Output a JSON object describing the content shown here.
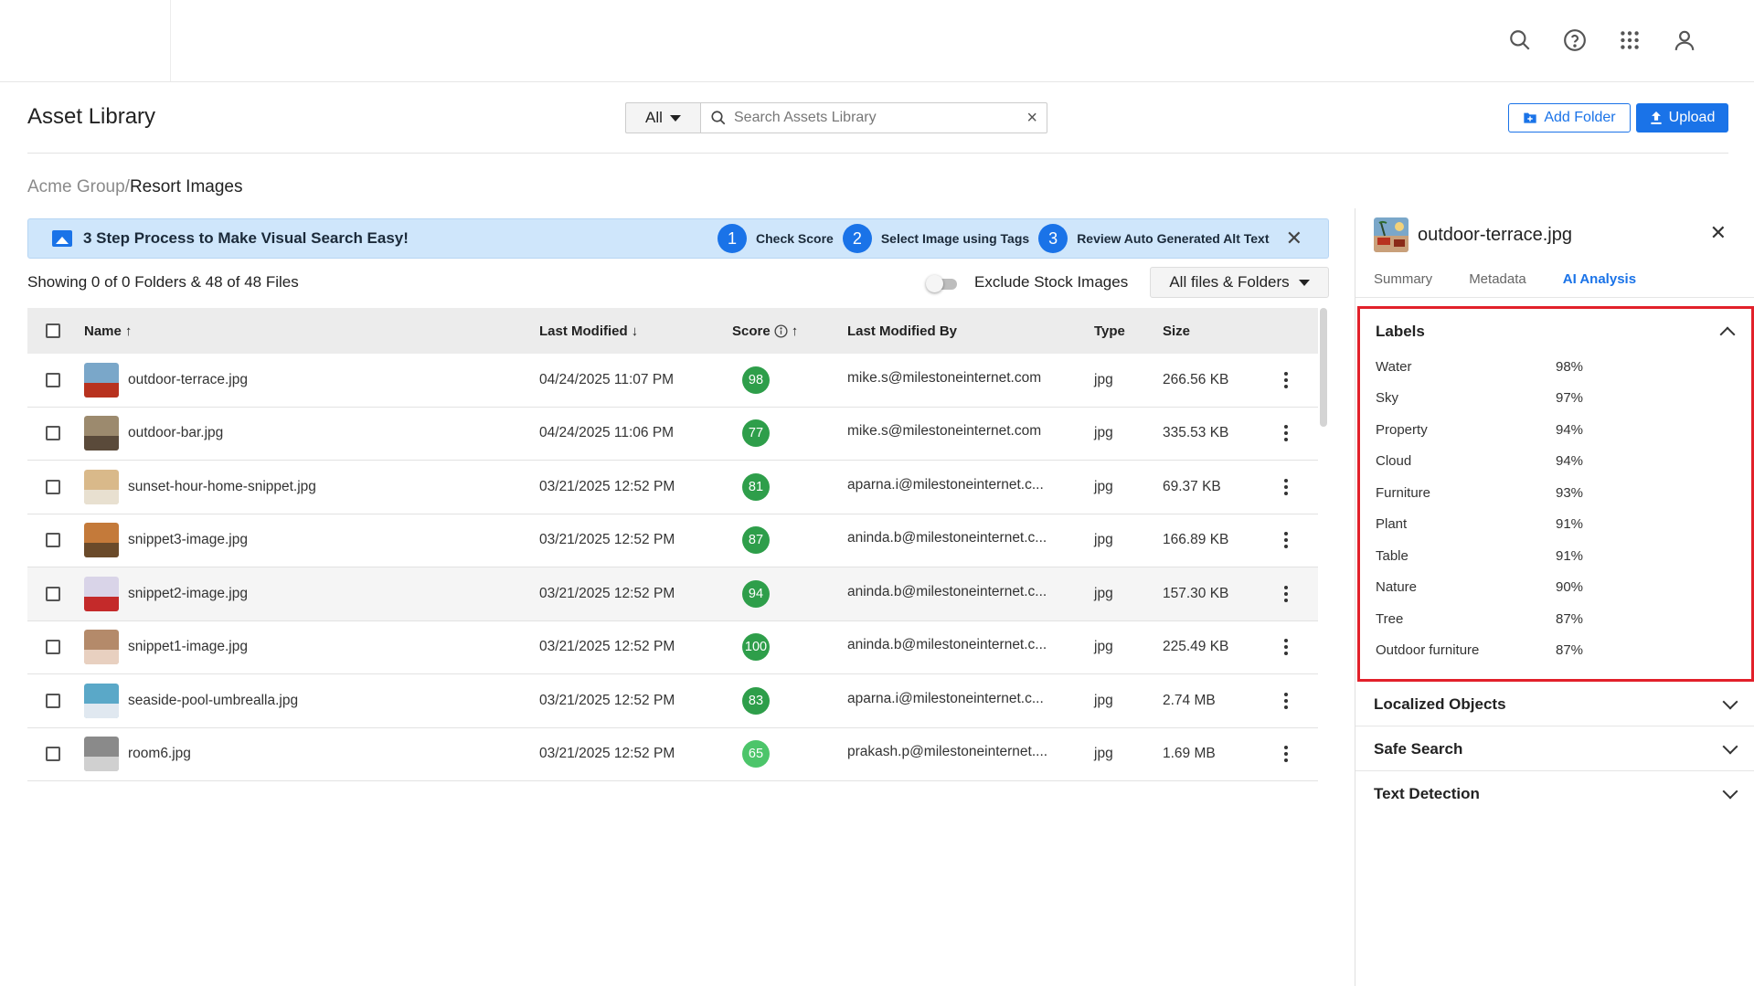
{
  "header": {
    "icons": [
      "search-icon",
      "help-icon",
      "apps-grid-icon",
      "account-icon"
    ]
  },
  "page": {
    "title": "Asset Library",
    "scope": "All",
    "search_placeholder": "Search Assets Library",
    "add_folder_label": "Add Folder",
    "upload_label": "Upload"
  },
  "breadcrumb": {
    "parent": "Acme Group/",
    "current": "Resort Images"
  },
  "banner": {
    "title": "3 Step Process to Make Visual Search Easy!",
    "steps": [
      {
        "num": "1",
        "label": "Check Score"
      },
      {
        "num": "2",
        "label": "Select Image using Tags"
      },
      {
        "num": "3",
        "label": "Review Auto Generated Alt Text"
      }
    ]
  },
  "toolbar": {
    "showing": "Showing 0 of 0 Folders & 48 of 48 Files",
    "exclude_stock_label": "Exclude Stock Images",
    "exclude_stock_on": false,
    "files_filter": "All files & Folders"
  },
  "table": {
    "columns": {
      "name": "Name",
      "last_modified": "Last Modified",
      "score": "Score",
      "modified_by": "Last Modified By",
      "type": "Type",
      "size": "Size"
    },
    "rows": [
      {
        "name": "outdoor-terrace.jpg",
        "modified": "04/24/2025 11:07 PM",
        "score": "98",
        "by": "mike.s@milestoneinternet.com",
        "type": "jpg",
        "size": "266.56 KB"
      },
      {
        "name": "outdoor-bar.jpg",
        "modified": "04/24/2025 11:06 PM",
        "score": "77",
        "by": "mike.s@milestoneinternet.com",
        "type": "jpg",
        "size": "335.53 KB"
      },
      {
        "name": "sunset-hour-home-snippet.jpg",
        "modified": "03/21/2025 12:52 PM",
        "score": "81",
        "by": "aparna.i@milestoneinternet.c...",
        "type": "jpg",
        "size": "69.37 KB"
      },
      {
        "name": "snippet3-image.jpg",
        "modified": "03/21/2025 12:52 PM",
        "score": "87",
        "by": "aninda.b@milestoneinternet.c...",
        "type": "jpg",
        "size": "166.89 KB"
      },
      {
        "name": "snippet2-image.jpg",
        "modified": "03/21/2025 12:52 PM",
        "score": "94",
        "by": "aninda.b@milestoneinternet.c...",
        "type": "jpg",
        "size": "157.30 KB"
      },
      {
        "name": "snippet1-image.jpg",
        "modified": "03/21/2025 12:52 PM",
        "score": "100",
        "by": "aninda.b@milestoneinternet.c...",
        "type": "jpg",
        "size": "225.49 KB"
      },
      {
        "name": "seaside-pool-umbrealla.jpg",
        "modified": "03/21/2025 12:52 PM",
        "score": "83",
        "by": "aparna.i@milestoneinternet.c...",
        "type": "jpg",
        "size": "2.74 MB"
      },
      {
        "name": "room6.jpg",
        "modified": "03/21/2025 12:52 PM",
        "score": "65",
        "by": "prakash.p@milestoneinternet....",
        "type": "jpg",
        "size": "1.69 MB"
      }
    ]
  },
  "panel": {
    "file_name": "outdoor-terrace.jpg",
    "tabs": [
      "Summary",
      "Metadata",
      "AI Analysis"
    ],
    "active_tab": "AI Analysis",
    "labels_title": "Labels",
    "labels": [
      {
        "name": "Water",
        "value": "98%"
      },
      {
        "name": "Sky",
        "value": "97%"
      },
      {
        "name": "Property",
        "value": "94%"
      },
      {
        "name": "Cloud",
        "value": "94%"
      },
      {
        "name": "Furniture",
        "value": "93%"
      },
      {
        "name": "Plant",
        "value": "91%"
      },
      {
        "name": "Table",
        "value": "91%"
      },
      {
        "name": "Nature",
        "value": "90%"
      },
      {
        "name": "Tree",
        "value": "87%"
      },
      {
        "name": "Outdoor furniture",
        "value": "87%"
      }
    ],
    "sections": [
      "Localized Objects",
      "Safe Search",
      "Text Detection"
    ]
  },
  "colors": {
    "accent": "#1a73e8",
    "score_green": "#2e9e4a",
    "highlight_border": "#e2202a",
    "banner_bg": "#cfe6fb"
  }
}
